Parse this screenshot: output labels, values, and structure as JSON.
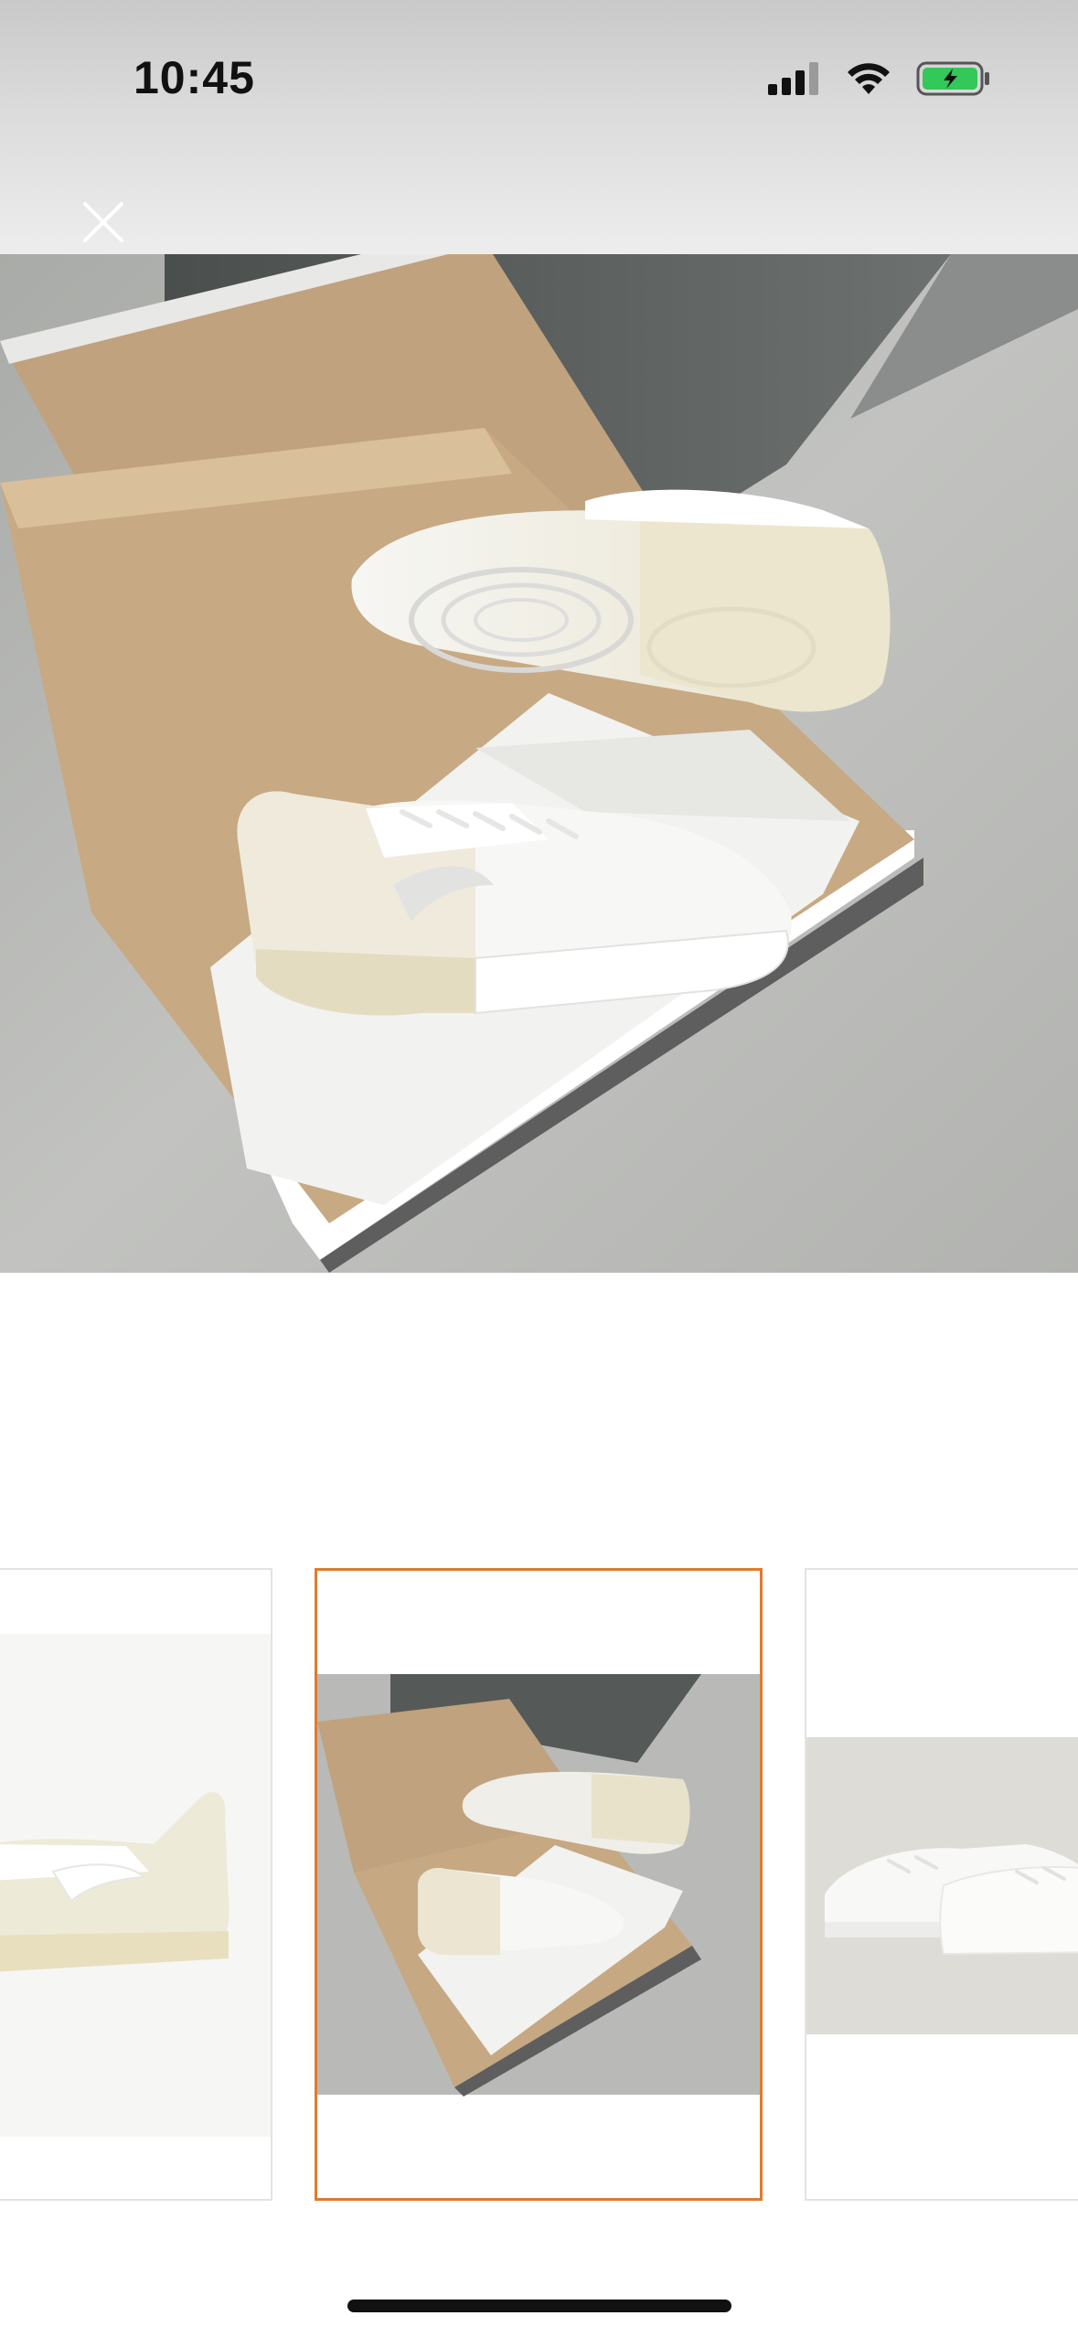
{
  "status_bar": {
    "time": "10:45",
    "icons": [
      "cellular-signal-icon",
      "wifi-icon",
      "battery-charging-icon"
    ],
    "battery_color": "#34c759"
  },
  "viewer": {
    "close_icon": "close-icon",
    "accent_color": "#e07a2f",
    "thumbnails": [
      {
        "index": 1,
        "selected": false
      },
      {
        "index": 2,
        "selected": true
      },
      {
        "index": 3,
        "selected": false
      }
    ]
  }
}
